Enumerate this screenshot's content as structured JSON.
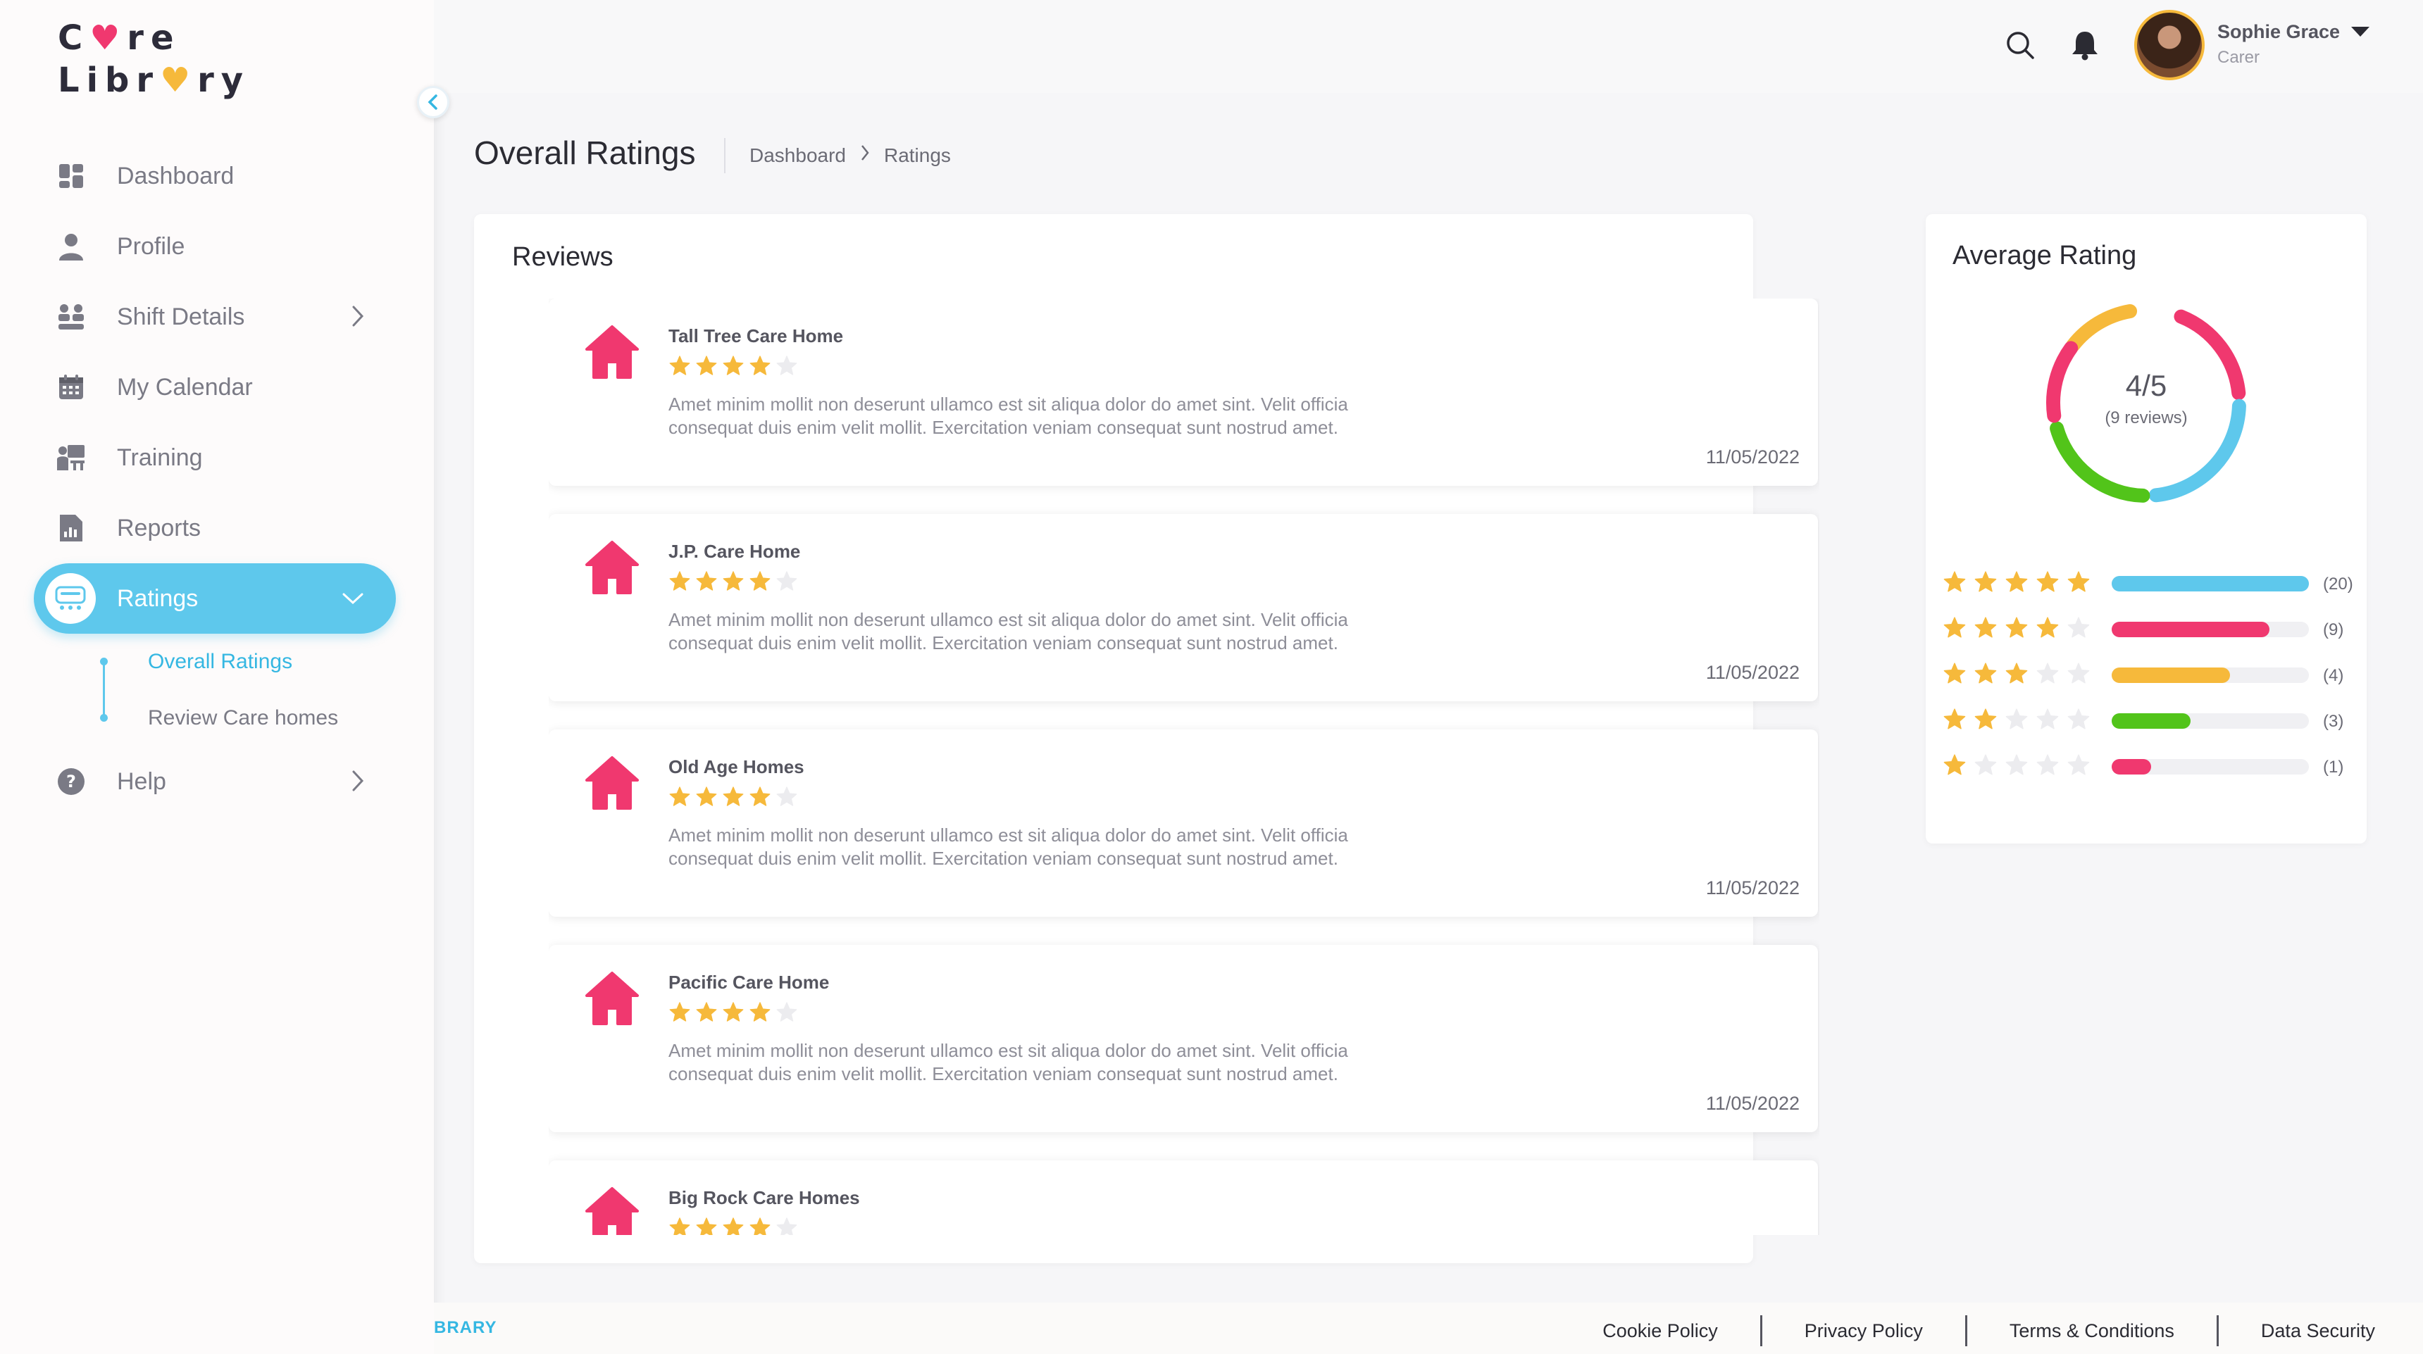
{
  "app": {
    "logo_line1_a": "C",
    "logo_line1_b": "re",
    "logo_line2_a": "Libr",
    "logo_line2_b": "ry"
  },
  "sidebar": {
    "items": [
      {
        "label": "Dashboard",
        "icon": "dashboard-icon"
      },
      {
        "label": "Profile",
        "icon": "person-icon"
      },
      {
        "label": "Shift Details",
        "icon": "shift-icon"
      },
      {
        "label": "My Calendar",
        "icon": "calendar-icon"
      },
      {
        "label": "Training",
        "icon": "training-icon"
      },
      {
        "label": "Reports",
        "icon": "report-icon"
      },
      {
        "label": "Ratings",
        "icon": "ratings-icon"
      },
      {
        "label": "Help",
        "icon": "help-icon"
      }
    ],
    "sub_items": [
      {
        "label": "Overall Ratings"
      },
      {
        "label": "Review Care homes"
      }
    ]
  },
  "user": {
    "name": "Sophie Grace",
    "role": "Carer"
  },
  "page": {
    "title": "Overall Ratings",
    "breadcrumb": [
      "Dashboard",
      "Ratings"
    ]
  },
  "reviews": {
    "title": "Reviews",
    "items": [
      {
        "name": "Tall Tree Care Home",
        "rating": 4,
        "text": "Amet minim mollit non deserunt ullamco est sit aliqua dolor do amet sint. Velit officia consequat duis enim velit mollit. Exercitation veniam consequat sunt nostrud amet.",
        "date": "11/05/2022"
      },
      {
        "name": "J.P. Care Home",
        "rating": 4,
        "text": "Amet minim mollit non deserunt ullamco est sit aliqua dolor do amet sint. Velit officia consequat duis enim velit mollit. Exercitation veniam consequat sunt nostrud amet.",
        "date": "11/05/2022"
      },
      {
        "name": "Old Age Homes",
        "rating": 4,
        "text": "Amet minim mollit non deserunt ullamco est sit aliqua dolor do amet sint. Velit officia consequat duis enim velit mollit. Exercitation veniam consequat sunt nostrud amet.",
        "date": "11/05/2022"
      },
      {
        "name": "Pacific Care Home",
        "rating": 4,
        "text": "Amet minim mollit non deserunt ullamco est sit aliqua dolor do amet sint. Velit officia consequat duis enim velit mollit. Exercitation veniam consequat sunt nostrud amet.",
        "date": "11/05/2022"
      },
      {
        "name": "Big Rock Care Homes",
        "rating": 4,
        "text": "",
        "date": ""
      }
    ]
  },
  "average": {
    "title": "Average Rating",
    "value": "4/5",
    "sub": "(9 reviews)",
    "donut_colors": [
      "#f6b93b",
      "#f0386f",
      "#5ec8ec",
      "#52c41a",
      "#f0386f"
    ],
    "distribution": [
      {
        "stars": 5,
        "count": "(20)",
        "fill": 1.0,
        "color": "#5ec8ec"
      },
      {
        "stars": 4,
        "count": "(9)",
        "fill": 0.8,
        "color": "#f0386f"
      },
      {
        "stars": 3,
        "count": "(4)",
        "fill": 0.6,
        "color": "#f6b93b"
      },
      {
        "stars": 2,
        "count": "(3)",
        "fill": 0.4,
        "color": "#52c41a"
      },
      {
        "stars": 1,
        "count": "(1)",
        "fill": 0.2,
        "color": "#f0386f"
      }
    ]
  },
  "footer": {
    "brand": "BRARY",
    "links": [
      "Cookie Policy",
      "Privacy Policy",
      "Terms & Conditions",
      "Data Security"
    ]
  },
  "colors": {
    "accent": "#5ec8ec",
    "brand_pink": "#f0386f",
    "star": "#f6b93b"
  }
}
